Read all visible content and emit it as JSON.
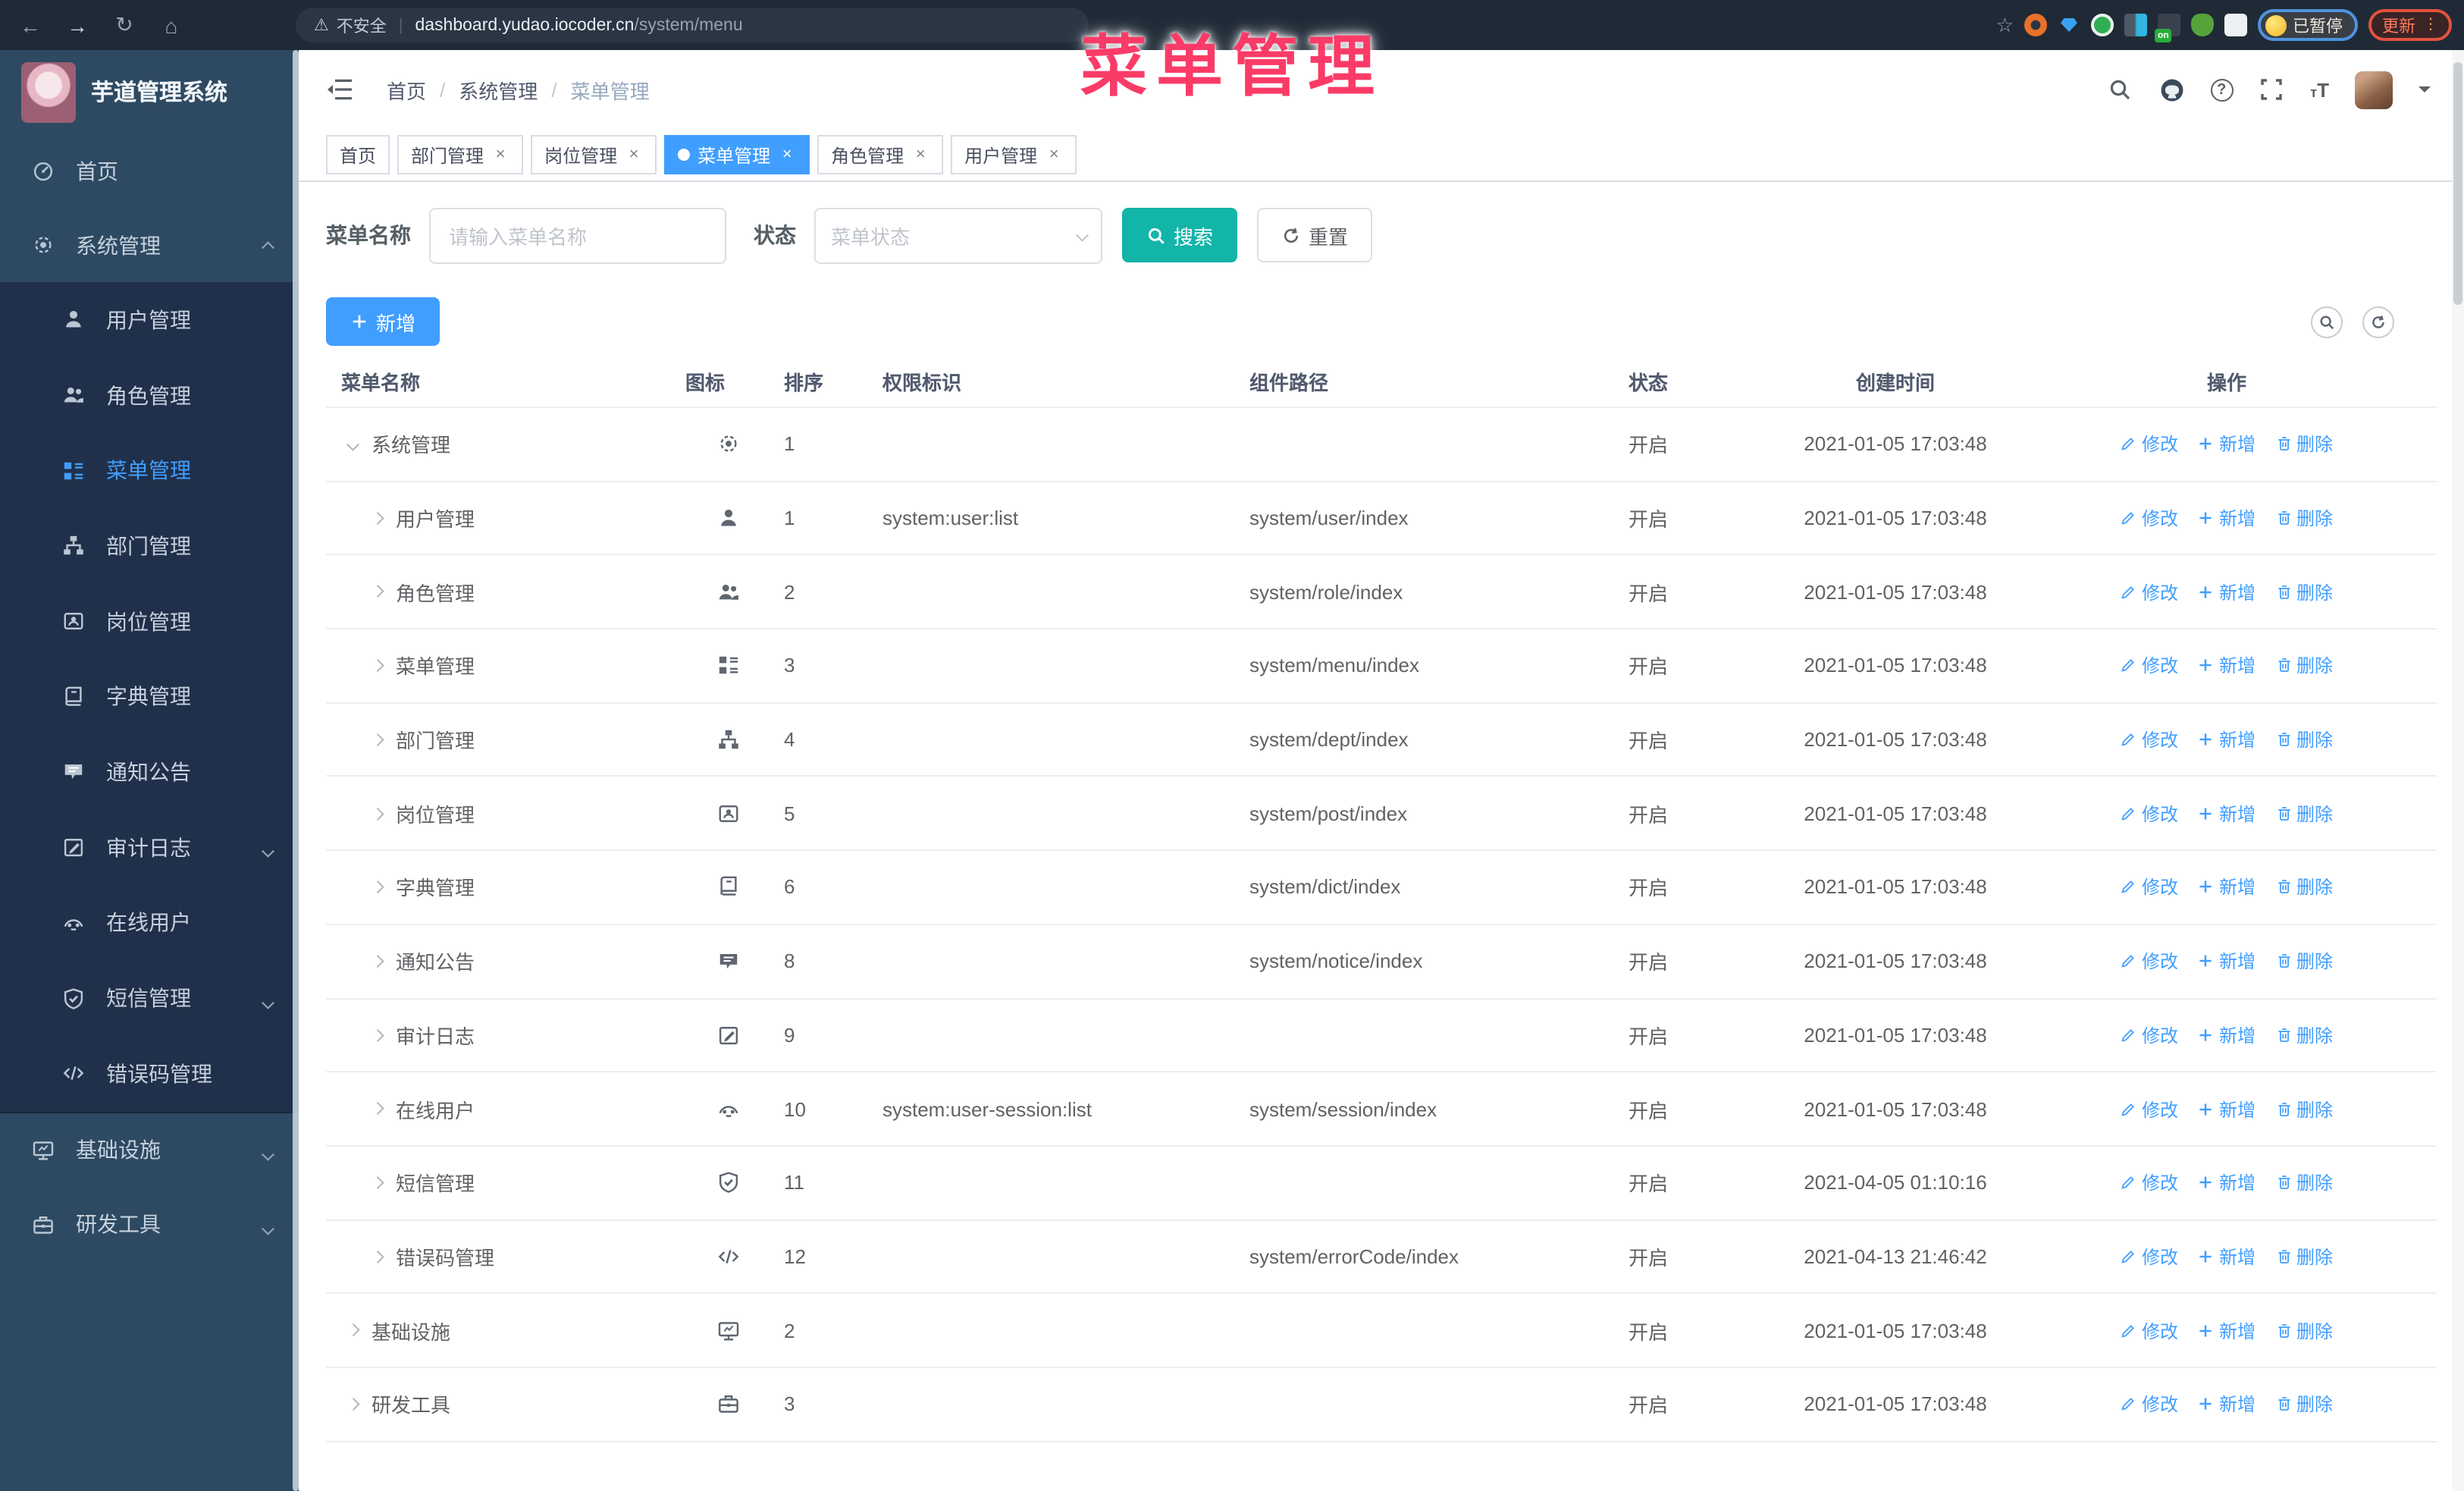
{
  "watermark": {
    "text": "菜单管理",
    "color": "#fa3b67"
  },
  "browser": {
    "security_label": "不安全",
    "url_host": "dashboard.yudao.iocoder.cn",
    "url_path": "/system/menu",
    "paused_label": "已暂停",
    "update_label": "更新",
    "on_badge": "on"
  },
  "sidebar": {
    "title": "芋道管理系统",
    "items": [
      {
        "label": "首页",
        "icon": "dashboard-icon",
        "group": "root"
      },
      {
        "label": "系统管理",
        "icon": "gear-icon",
        "group": "root",
        "chevron": "up"
      },
      {
        "label": "用户管理",
        "icon": "user-icon",
        "group": "sub"
      },
      {
        "label": "角色管理",
        "icon": "users-icon",
        "group": "sub"
      },
      {
        "label": "菜单管理",
        "icon": "menu-icon",
        "group": "sub",
        "active": true
      },
      {
        "label": "部门管理",
        "icon": "org-icon",
        "group": "sub"
      },
      {
        "label": "岗位管理",
        "icon": "badge-icon",
        "group": "sub"
      },
      {
        "label": "字典管理",
        "icon": "dict-icon",
        "group": "sub"
      },
      {
        "label": "通知公告",
        "icon": "message-icon",
        "group": "sub"
      },
      {
        "label": "审计日志",
        "icon": "log-icon",
        "group": "sub",
        "chevron": "down"
      },
      {
        "label": "在线用户",
        "icon": "online-icon",
        "group": "sub"
      },
      {
        "label": "短信管理",
        "icon": "sms-icon",
        "group": "sub",
        "chevron": "down"
      },
      {
        "label": "错误码管理",
        "icon": "code-icon",
        "group": "sub"
      },
      {
        "label": "基础设施",
        "icon": "infra-icon",
        "group": "root2",
        "chevron": "down"
      },
      {
        "label": "研发工具",
        "icon": "tool-icon",
        "group": "root2",
        "chevron": "down"
      }
    ]
  },
  "topbar": {
    "breadcrumb": [
      "首页",
      "系统管理",
      "菜单管理"
    ],
    "separator": "/"
  },
  "tags": [
    {
      "label": "首页",
      "closable": false,
      "active": false
    },
    {
      "label": "部门管理",
      "closable": true,
      "active": false
    },
    {
      "label": "岗位管理",
      "closable": true,
      "active": false
    },
    {
      "label": "菜单管理",
      "closable": true,
      "active": true
    },
    {
      "label": "角色管理",
      "closable": true,
      "active": false
    },
    {
      "label": "用户管理",
      "closable": true,
      "active": false
    }
  ],
  "filters": {
    "name_label": "菜单名称",
    "name_placeholder": "请输入菜单名称",
    "status_label": "状态",
    "status_placeholder": "菜单状态",
    "search_label": "搜索",
    "reset_label": "重置"
  },
  "toolbar": {
    "add_label": "新增"
  },
  "table": {
    "columns": [
      "菜单名称",
      "图标",
      "排序",
      "权限标识",
      "组件路径",
      "状态",
      "创建时间",
      "操作"
    ],
    "actions": {
      "edit": "修改",
      "add": "新增",
      "remove": "删除"
    },
    "rows": [
      {
        "name": "系统管理",
        "icon": "gear-icon",
        "level": 0,
        "expanded": true,
        "sort": "1",
        "perm": "",
        "path": "",
        "status": "开启",
        "time": "2021-01-05 17:03:48"
      },
      {
        "name": "用户管理",
        "icon": "user-icon",
        "level": 1,
        "expanded": false,
        "sort": "1",
        "perm": "system:user:list",
        "path": "system/user/index",
        "status": "开启",
        "time": "2021-01-05 17:03:48"
      },
      {
        "name": "角色管理",
        "icon": "users-icon",
        "level": 1,
        "expanded": false,
        "sort": "2",
        "perm": "",
        "path": "system/role/index",
        "status": "开启",
        "time": "2021-01-05 17:03:48"
      },
      {
        "name": "菜单管理",
        "icon": "menu-icon",
        "level": 1,
        "expanded": false,
        "sort": "3",
        "perm": "",
        "path": "system/menu/index",
        "status": "开启",
        "time": "2021-01-05 17:03:48"
      },
      {
        "name": "部门管理",
        "icon": "org-icon",
        "level": 1,
        "expanded": false,
        "sort": "4",
        "perm": "",
        "path": "system/dept/index",
        "status": "开启",
        "time": "2021-01-05 17:03:48"
      },
      {
        "name": "岗位管理",
        "icon": "badge-icon",
        "level": 1,
        "expanded": false,
        "sort": "5",
        "perm": "",
        "path": "system/post/index",
        "status": "开启",
        "time": "2021-01-05 17:03:48"
      },
      {
        "name": "字典管理",
        "icon": "dict-icon",
        "level": 1,
        "expanded": false,
        "sort": "6",
        "perm": "",
        "path": "system/dict/index",
        "status": "开启",
        "time": "2021-01-05 17:03:48"
      },
      {
        "name": "通知公告",
        "icon": "message-icon",
        "level": 1,
        "expanded": false,
        "sort": "8",
        "perm": "",
        "path": "system/notice/index",
        "status": "开启",
        "time": "2021-01-05 17:03:48"
      },
      {
        "name": "审计日志",
        "icon": "log-icon",
        "level": 1,
        "expanded": false,
        "sort": "9",
        "perm": "",
        "path": "",
        "status": "开启",
        "time": "2021-01-05 17:03:48"
      },
      {
        "name": "在线用户",
        "icon": "online-icon",
        "level": 1,
        "expanded": false,
        "sort": "10",
        "perm": "system:user-session:list",
        "path": "system/session/index",
        "status": "开启",
        "time": "2021-01-05 17:03:48"
      },
      {
        "name": "短信管理",
        "icon": "sms-icon",
        "level": 1,
        "expanded": false,
        "sort": "11",
        "perm": "",
        "path": "",
        "status": "开启",
        "time": "2021-04-05 01:10:16"
      },
      {
        "name": "错误码管理",
        "icon": "code-icon",
        "level": 1,
        "expanded": false,
        "sort": "12",
        "perm": "",
        "path": "system/errorCode/index",
        "status": "开启",
        "time": "2021-04-13 21:46:42"
      },
      {
        "name": "基础设施",
        "icon": "infra-icon",
        "level": 0,
        "expanded": false,
        "sort": "2",
        "perm": "",
        "path": "",
        "status": "开启",
        "time": "2021-01-05 17:03:48"
      },
      {
        "name": "研发工具",
        "icon": "tool-icon",
        "level": 0,
        "expanded": false,
        "sort": "3",
        "perm": "",
        "path": "",
        "status": "开启",
        "time": "2021-01-05 17:03:48"
      }
    ]
  }
}
